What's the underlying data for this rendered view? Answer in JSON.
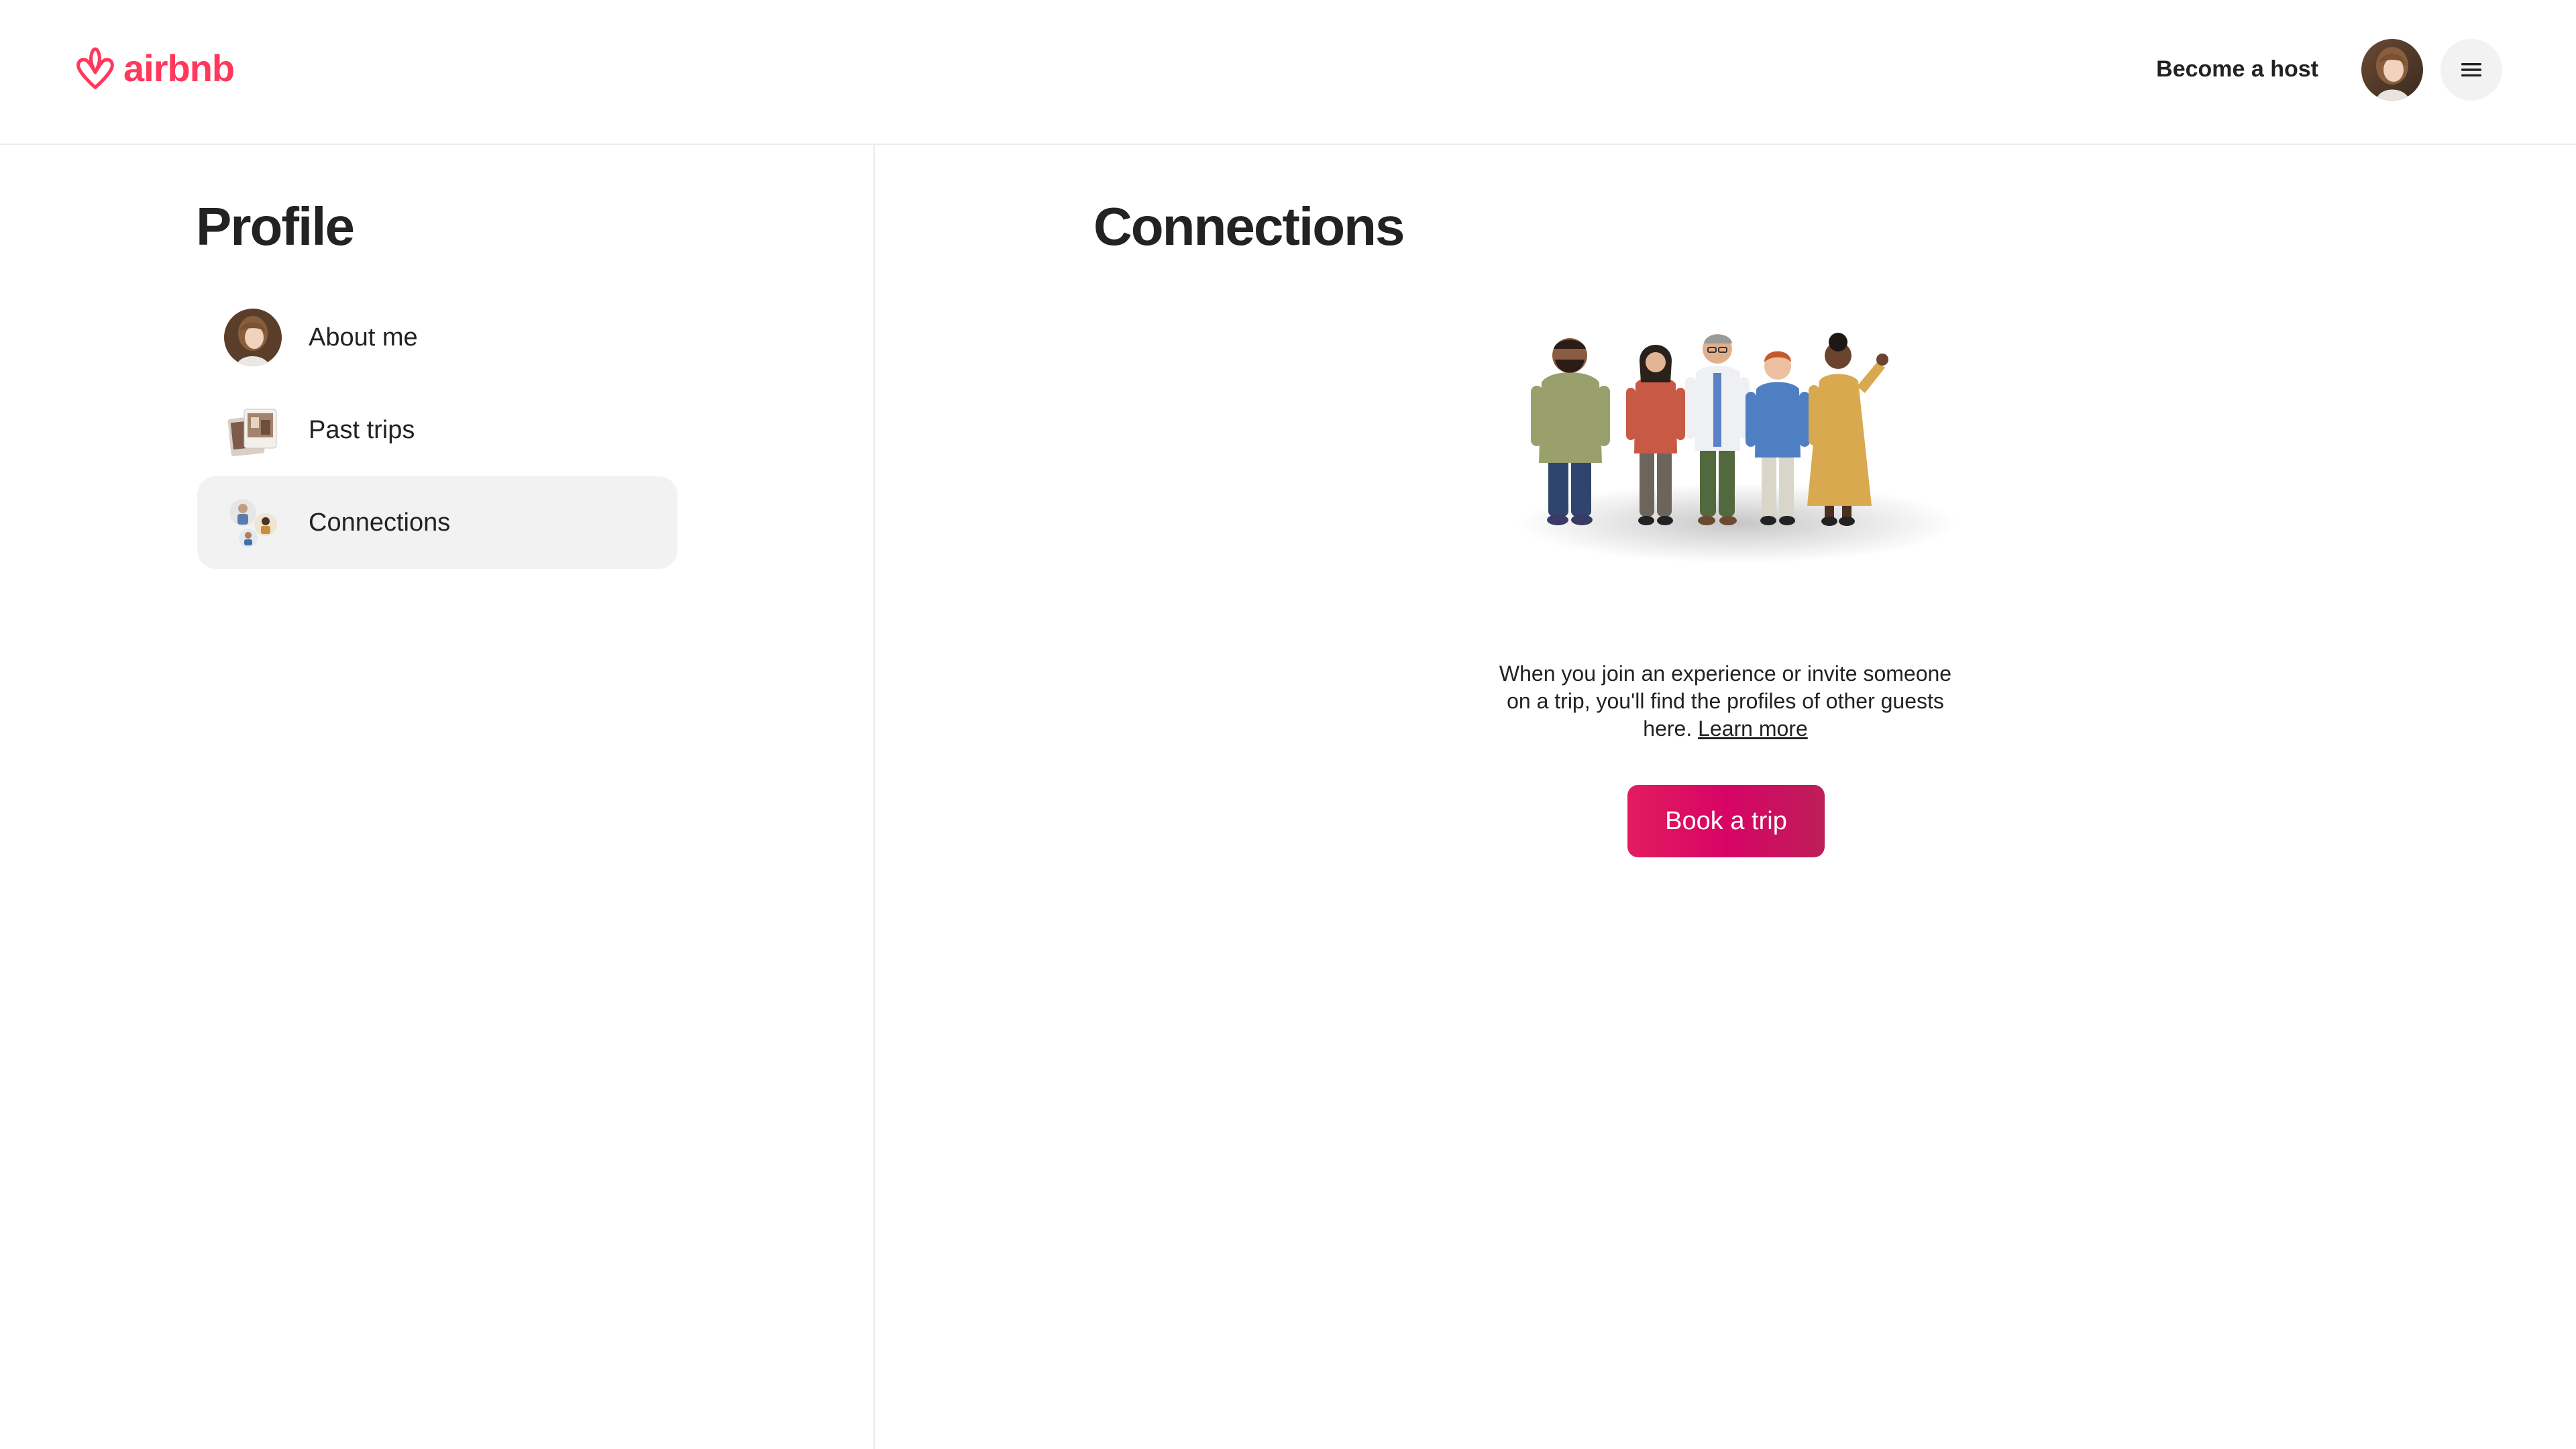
{
  "brand": {
    "name": "airbnb",
    "color": "#FF385C"
  },
  "header": {
    "become_host_label": "Become a host",
    "avatar_icon": "user-avatar-icon",
    "menu_icon": "hamburger-menu-icon"
  },
  "sidebar": {
    "title": "Profile",
    "items": [
      {
        "label": "About me",
        "icon": "avatar-icon",
        "active": false
      },
      {
        "label": "Past trips",
        "icon": "suitcase-photos-icon",
        "active": false
      },
      {
        "label": "Connections",
        "icon": "people-icon",
        "active": true
      }
    ]
  },
  "main": {
    "title": "Connections",
    "illustration": "group-of-people-illustration",
    "description": "When you join an experience or invite someone on a trip, you'll find the profiles of other guests here.",
    "learn_more_label": "Learn more",
    "book_button_label": "Book a trip",
    "book_button_color": "#D70466"
  }
}
